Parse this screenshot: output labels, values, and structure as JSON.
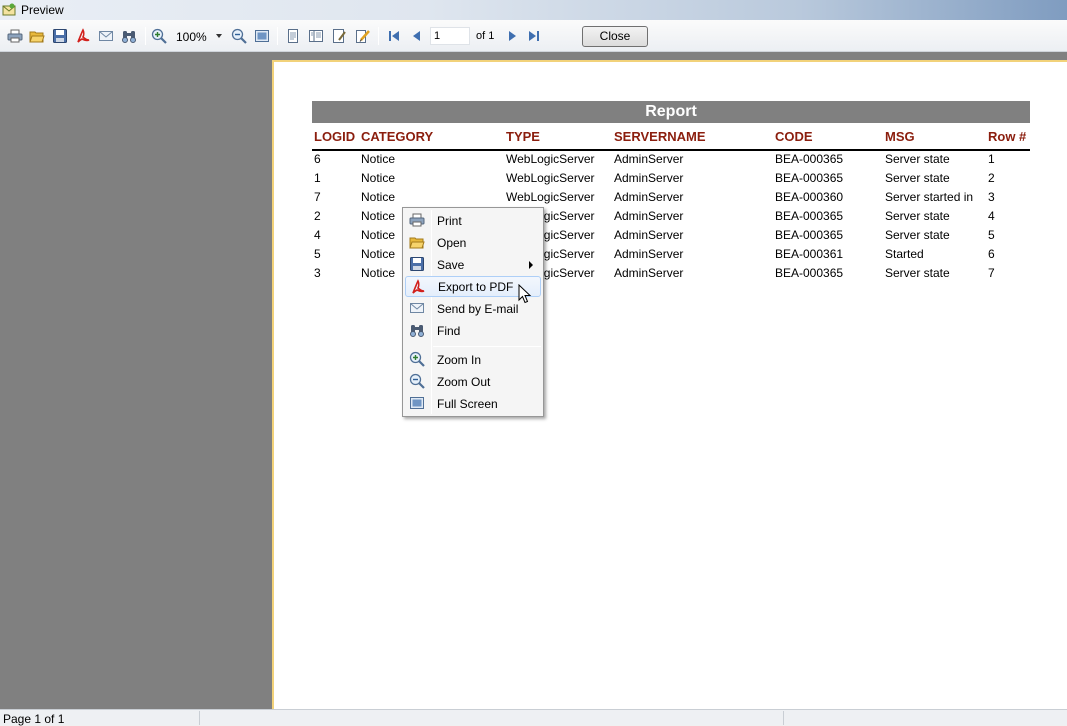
{
  "window": {
    "title": "Preview"
  },
  "toolbar": {
    "zoom_value": "100%",
    "page_value": "1",
    "page_of": "of 1",
    "close_label": "Close",
    "icons": [
      "print-icon",
      "open-icon",
      "save-icon",
      "pdf-icon",
      "email-icon",
      "find-icon",
      "zoom-in-icon",
      "zoom-out-icon",
      "full-screen-icon",
      "single-page-icon",
      "two-page-icon",
      "page-setup-icon",
      "edit-icon",
      "first-page-icon",
      "prev-page-icon",
      "next-page-icon",
      "last-page-icon"
    ]
  },
  "report": {
    "title": "Report",
    "columns": [
      "LOGID",
      "CATEGORY",
      "TYPE",
      "SERVERNAME",
      "CODE",
      "MSG",
      "Row #"
    ],
    "rows": [
      [
        "6",
        "Notice",
        "WebLogicServer",
        "AdminServer",
        "BEA-000365",
        "Server state",
        "1"
      ],
      [
        "1",
        "Notice",
        "WebLogicServer",
        "AdminServer",
        "BEA-000365",
        "Server state",
        "2"
      ],
      [
        "7",
        "Notice",
        "WebLogicServer",
        "AdminServer",
        "BEA-000360",
        "Server started in",
        "3"
      ],
      [
        "2",
        "Notice",
        "WebLogicServer",
        "AdminServer",
        "BEA-000365",
        "Server state",
        "4"
      ],
      [
        "4",
        "Notice",
        "WebLogicServer",
        "AdminServer",
        "BEA-000365",
        "Server state",
        "5"
      ],
      [
        "5",
        "Notice",
        "WebLogicServer",
        "AdminServer",
        "BEA-000361",
        "Started",
        "6"
      ],
      [
        "3",
        "Notice",
        "WebLogicServer",
        "AdminServer",
        "BEA-000365",
        "Server state",
        "7"
      ]
    ]
  },
  "context_menu": {
    "items": [
      {
        "label": "Print",
        "icon": "print-icon"
      },
      {
        "label": "Open",
        "icon": "open-icon"
      },
      {
        "label": "Save",
        "icon": "save-icon",
        "submenu": true
      },
      {
        "label": "Export to PDF",
        "icon": "pdf-icon",
        "highlighted": true
      },
      {
        "label": "Send by E-mail",
        "icon": "email-icon"
      },
      {
        "label": "Find",
        "icon": "find-icon"
      },
      {
        "label": "Zoom In",
        "icon": "zoom-in-icon"
      },
      {
        "label": "Zoom Out",
        "icon": "zoom-out-icon"
      },
      {
        "label": "Full Screen",
        "icon": "full-screen-icon"
      }
    ]
  },
  "statusbar": {
    "text": "Page 1 of 1"
  },
  "colors": {
    "header_text": "#8b1e0e",
    "title_bar_bg": "#808080",
    "page_border": "#f2d27a"
  }
}
